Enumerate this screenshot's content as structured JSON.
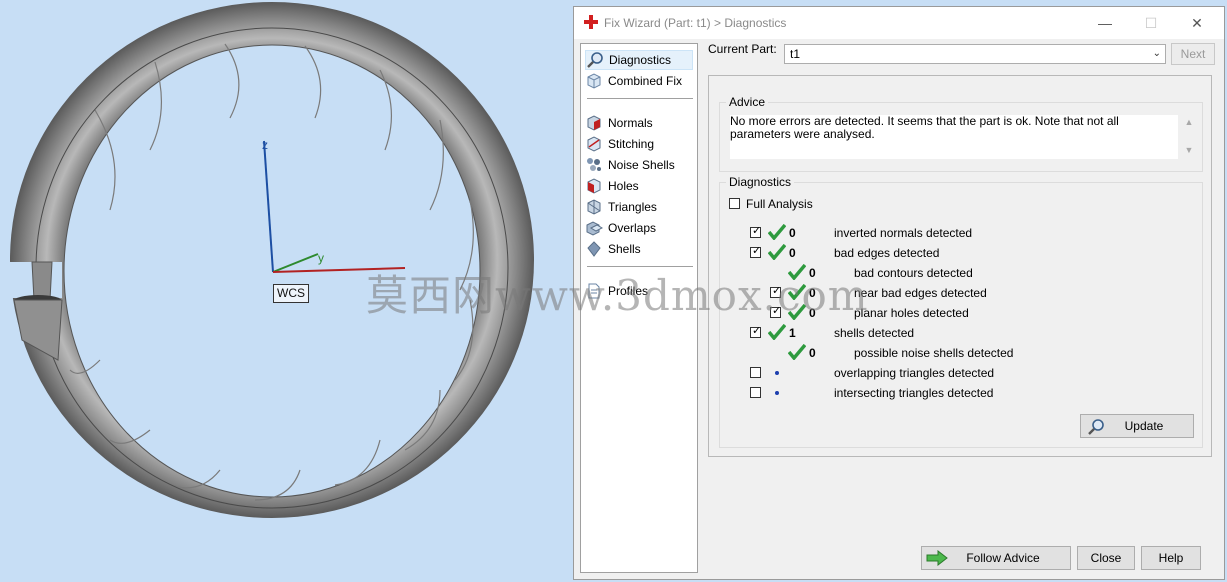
{
  "viewport": {
    "axis_z": "z",
    "axis_y": "y",
    "wcs_label": "WCS",
    "watermark": "莫西网www.3dmox.com"
  },
  "window": {
    "title": "Fix Wizard (Part: t1) > Diagnostics",
    "minimize": "—",
    "maximize": "☐",
    "close": "✕"
  },
  "sidebar": {
    "items": [
      {
        "label": "Diagnostics",
        "icon": "magnifier-icon",
        "selected": true
      },
      {
        "label": "Combined Fix",
        "icon": "cube-icon"
      },
      {
        "label": "Normals",
        "icon": "normals-cube-icon"
      },
      {
        "label": "Stitching",
        "icon": "stitching-icon"
      },
      {
        "label": "Noise Shells",
        "icon": "noise-shells-icon"
      },
      {
        "label": "Holes",
        "icon": "holes-icon"
      },
      {
        "label": "Triangles",
        "icon": "triangles-icon"
      },
      {
        "label": "Overlaps",
        "icon": "overlaps-icon"
      },
      {
        "label": "Shells",
        "icon": "shells-icon"
      },
      {
        "label": "Profiles",
        "icon": "profiles-icon"
      }
    ]
  },
  "header": {
    "current_part_label": "Current Part:",
    "current_part_value": "t1",
    "next_button": "Next"
  },
  "advice": {
    "title": "Advice",
    "text": "No more errors are detected. It seems that the part is ok. Note that not all parameters were analysed."
  },
  "diagnostics": {
    "title": "Diagnostics",
    "full_analysis_label": "Full Analysis",
    "rows": [
      {
        "checkbox": true,
        "checked": true,
        "status": "check",
        "count": "0",
        "label": "inverted normals detected",
        "indent": 0
      },
      {
        "checkbox": true,
        "checked": true,
        "status": "check",
        "count": "0",
        "label": "bad edges detected",
        "indent": 0
      },
      {
        "checkbox": false,
        "checked": false,
        "status": "check",
        "count": "0",
        "label": "bad contours detected",
        "indent": 1
      },
      {
        "checkbox": true,
        "checked": true,
        "status": "check",
        "count": "0",
        "label": "near bad edges detected",
        "indent": 1
      },
      {
        "checkbox": true,
        "checked": true,
        "status": "check",
        "count": "0",
        "label": "planar holes detected",
        "indent": 1
      },
      {
        "checkbox": true,
        "checked": true,
        "status": "check",
        "count": "1",
        "label": "shells detected",
        "indent": 0
      },
      {
        "checkbox": false,
        "checked": false,
        "status": "check",
        "count": "0",
        "label": "possible noise shells detected",
        "indent": 1
      },
      {
        "checkbox": true,
        "checked": false,
        "status": "dot",
        "count": "",
        "label": "overlapping triangles detected",
        "indent": 0
      },
      {
        "checkbox": true,
        "checked": false,
        "status": "dot",
        "count": "",
        "label": "intersecting triangles detected",
        "indent": 0
      }
    ],
    "update_button": "Update"
  },
  "footer": {
    "follow_advice_button": "Follow Advice",
    "close_button": "Close",
    "help_button": "Help"
  },
  "colors": {
    "viewport_bg": "#c7def5",
    "check_green": "#2e9a3e",
    "ring_gray": "#8f8f8f"
  }
}
